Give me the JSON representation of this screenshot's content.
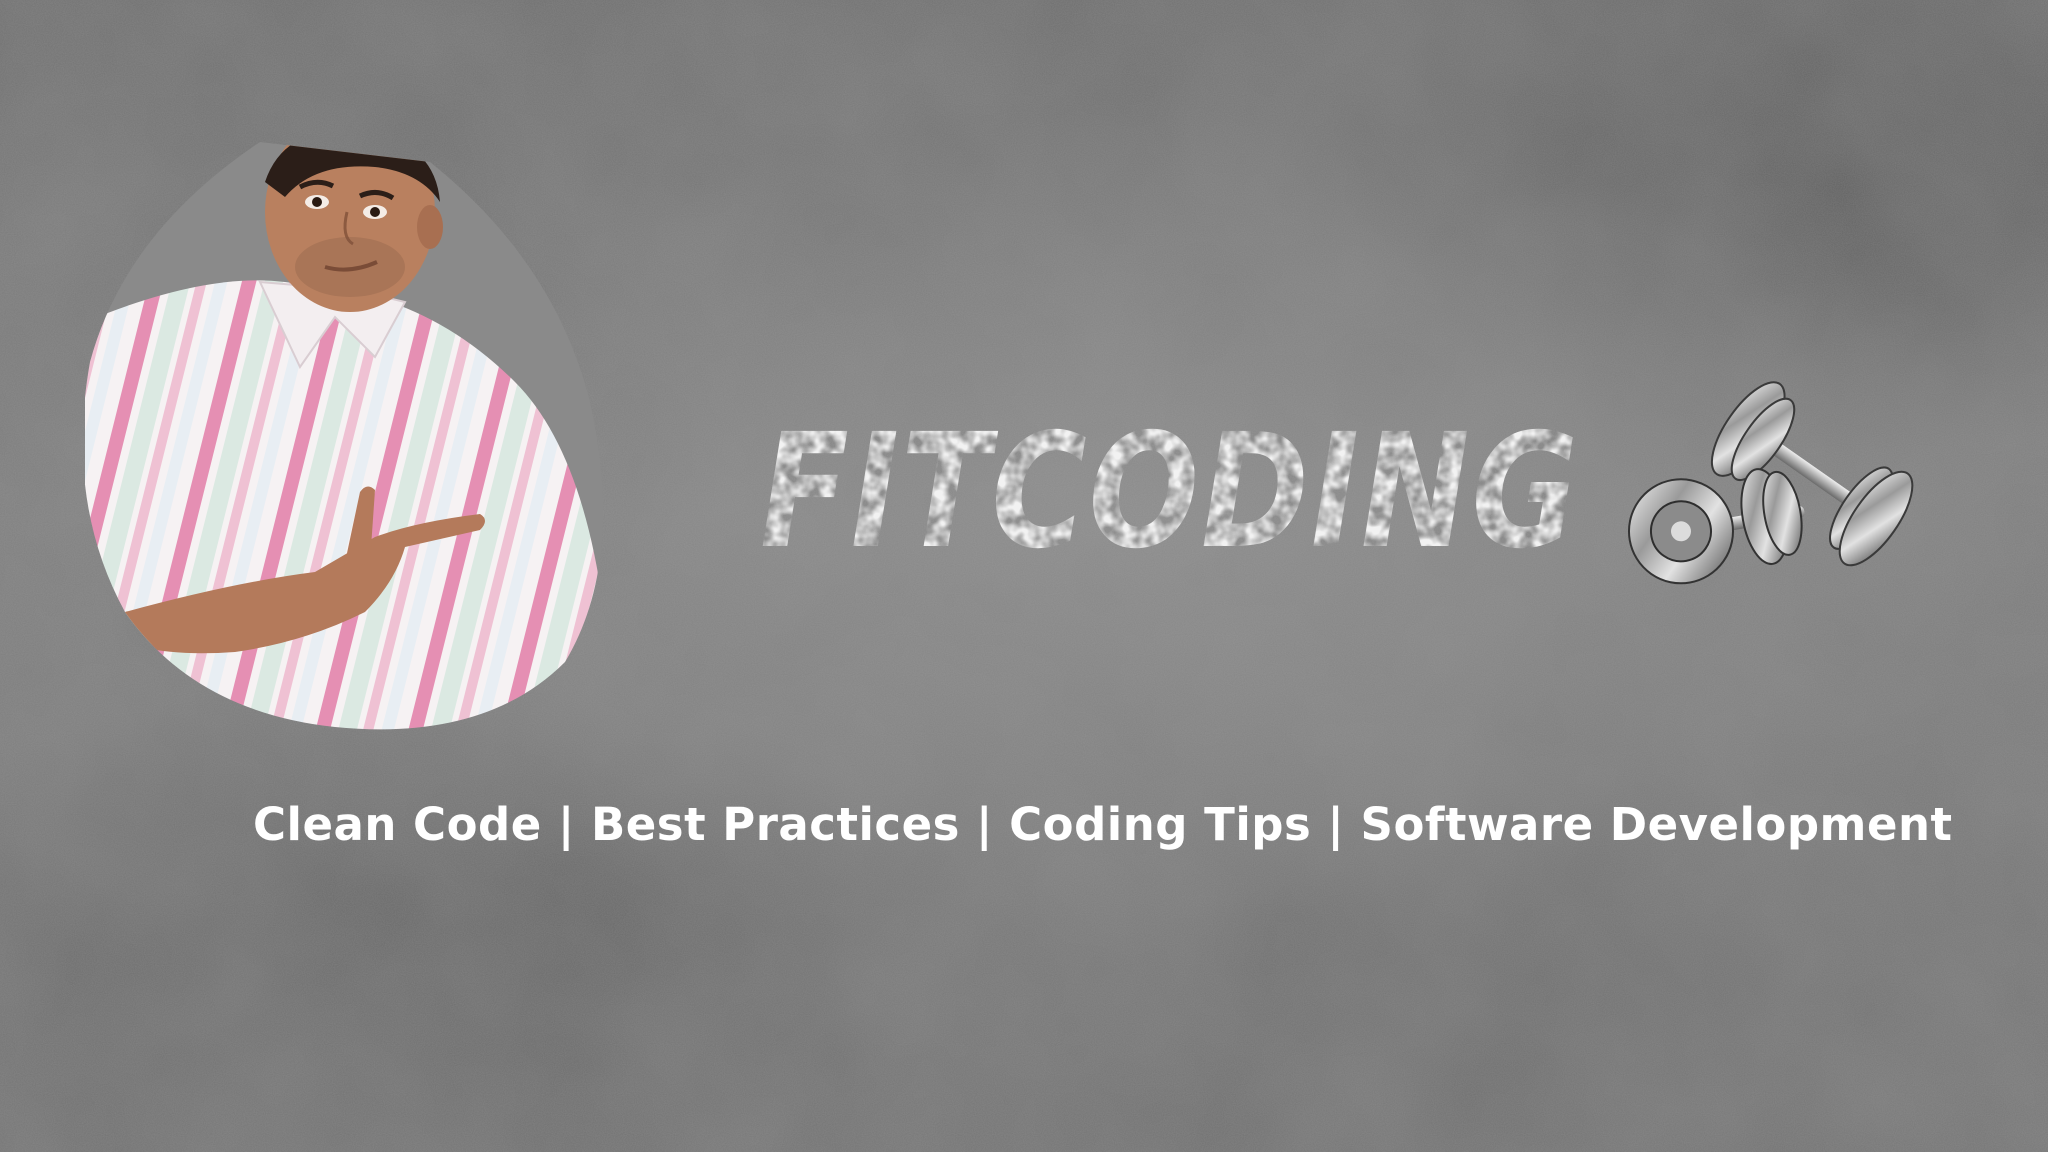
{
  "banner": {
    "logo_text": "FITCODING",
    "tagline": "Clean Code | Best Practices | Coding Tips | Software Development",
    "colors": {
      "background": "#757575",
      "text": "#ffffff",
      "shirt_stripe": "#e58fb3"
    },
    "icons": [
      "dumbbell-icon"
    ]
  }
}
